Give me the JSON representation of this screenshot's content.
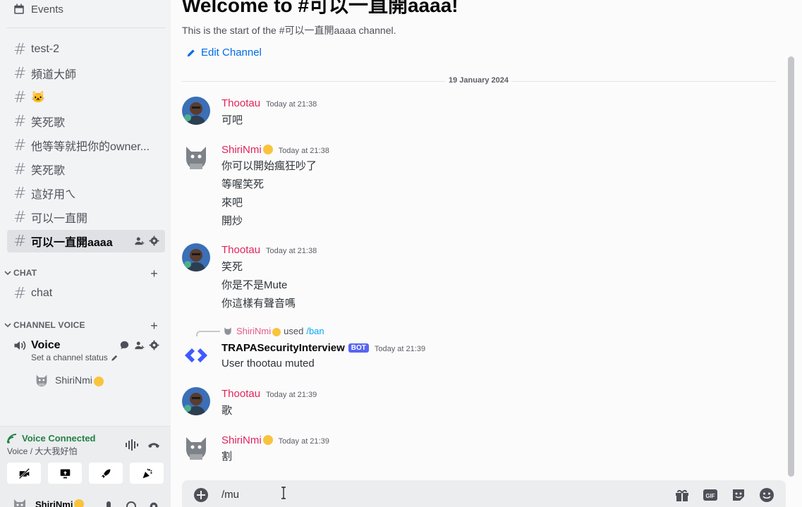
{
  "sidebar": {
    "events_label": "Events",
    "channels": [
      {
        "label": "test-2"
      },
      {
        "label": "頻道大師"
      },
      {
        "label": "🐱"
      },
      {
        "label": "笑死歌"
      },
      {
        "label": "他等等就把你的owner..."
      },
      {
        "label": "笑死歌"
      },
      {
        "label": "這好用ㄟ"
      },
      {
        "label": "可以一直開"
      },
      {
        "label": "可以一直開aaaa"
      }
    ],
    "categories": {
      "chat": "CHAT",
      "channel_voice": "CHANNEL VOICE"
    },
    "chat_channel": "chat",
    "voice_channel": {
      "label": "Voice",
      "status": "Set a channel status",
      "user": "ShiriNmi"
    }
  },
  "voice_panel": {
    "title": "Voice Connected",
    "subtitle": "Voice / 大大我好怕"
  },
  "userbar": {
    "name": "ShiriNmi"
  },
  "main": {
    "welcome_title": "Welcome to #可以一直開aaaa!",
    "start_text": "This is the start of the #可以一直開aaaa channel.",
    "edit_channel": "Edit Channel",
    "date_divider": "19 January 2024",
    "messages": [
      {
        "author": "Thootau",
        "time": "Today at 21:38",
        "lines": [
          "可吧"
        ]
      },
      {
        "author": "ShiriNmi",
        "time": "Today at 21:38",
        "lines": [
          "你可以開始瘋狂吵了",
          "等喔笑死",
          "來吧",
          "開炒"
        ]
      },
      {
        "author": "Thootau",
        "time": "Today at 21:38",
        "lines": [
          "笑死",
          "你是不是Mute",
          "你這樣有聲音嗎"
        ]
      },
      {
        "author": "TRAPASecurityInterview",
        "time": "Today at 21:39",
        "tag": "BOT",
        "lines": [
          "User thootau muted"
        ],
        "reply_user": "ShiriNmi",
        "reply_used": "used",
        "reply_cmd": "/ban"
      },
      {
        "author": "Thootau",
        "time": "Today at 21:39",
        "lines": [
          "歌"
        ]
      },
      {
        "author": "ShiriNmi",
        "time": "Today at 21:39",
        "lines": [
          "割"
        ]
      }
    ],
    "composer_value": "/mu"
  },
  "colors": {
    "author_pink": "#e0245e",
    "link_blue": "#006ce7",
    "voice_green": "#248046",
    "bot_blurple": "#5865f2"
  }
}
